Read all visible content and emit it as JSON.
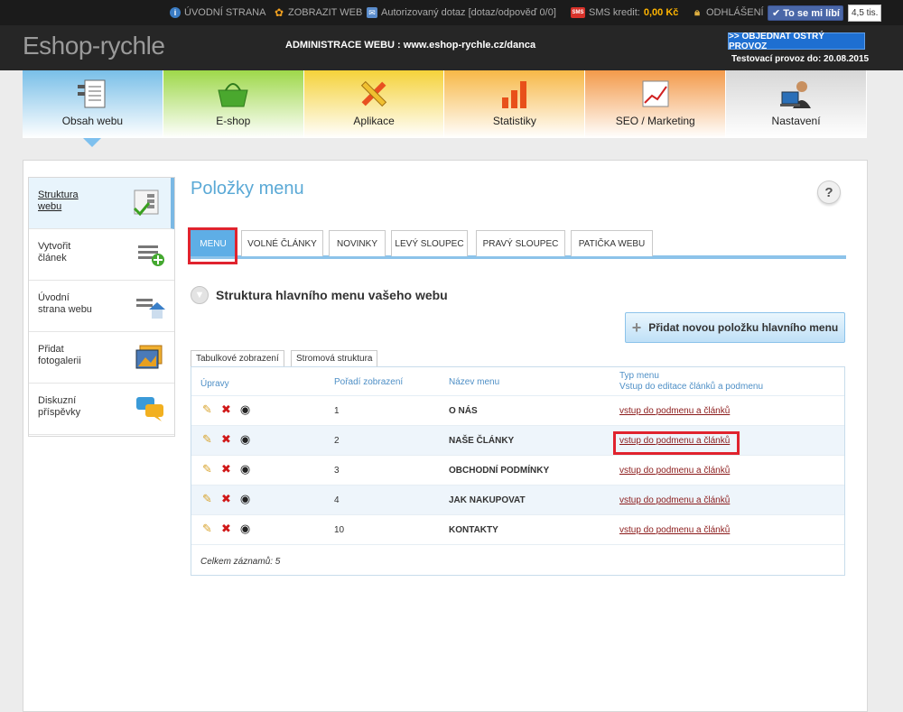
{
  "topbar": {
    "home": "ÚVODNÍ STRANA",
    "show_web": "ZOBRAZIT WEB",
    "query": "Autorizovaný dotaz [dotaz/odpověď 0/0]",
    "sms_label": "SMS kredit:",
    "sms_value": "0,00 Kč",
    "logout": "ODHLÁŠENÍ",
    "like": "To se mi líbí",
    "like_count": "4,5 tis.",
    "sms_badge": "SMS"
  },
  "header": {
    "logo": "Eshop-rychle",
    "admin_title": "ADMINISTRACE WEBU : www.eshop-rychle.cz/danca",
    "order_button": ">> OBJEDNAT OSTRÝ PROVOZ",
    "test_date": "Testovací provoz do: 20.08.2015"
  },
  "nav": [
    {
      "label": "Obsah webu",
      "icon": "document-list-icon",
      "color": "#79bfe8"
    },
    {
      "label": "E-shop",
      "icon": "basket-icon",
      "color": "#9ed84a"
    },
    {
      "label": "Aplikace",
      "icon": "tools-icon",
      "color": "#f5d23a"
    },
    {
      "label": "Statistiky",
      "icon": "bar-chart-icon",
      "color": "#f7b847"
    },
    {
      "label": "SEO / Marketing",
      "icon": "growth-chart-icon",
      "color": "#f39a4a"
    },
    {
      "label": "Nastavení",
      "icon": "person-laptop-icon",
      "color": "#d7d7d7"
    }
  ],
  "sidebar": [
    {
      "label": "Struktura webu",
      "icon": "sitemap-check-icon"
    },
    {
      "label": "Vytvořit článek",
      "icon": "add-article-icon"
    },
    {
      "label": "Úvodní strana webu",
      "icon": "home-page-icon"
    },
    {
      "label": "Přidat fotogalerii",
      "icon": "gallery-icon"
    },
    {
      "label": "Diskuzní příspěvky",
      "icon": "chat-bubbles-icon"
    }
  ],
  "page": {
    "title": "Položky menu",
    "help": "?",
    "tabs": [
      "MENU",
      "VOLNÉ ČLÁNKY",
      "NOVINKY",
      "LEVÝ SLOUPEC",
      "PRAVÝ SLOUPEC",
      "PATIČKA WEBU"
    ],
    "section_title": "Struktura hlavního menu vašeho webu",
    "add_button": "Přidat novou položku hlavního menu",
    "view_tabs": [
      "Tabulkové zobrazení",
      "Stromová struktura"
    ]
  },
  "table": {
    "headers": {
      "actions": "Úpravy",
      "order": "Pořadí zobrazení",
      "name": "Název menu",
      "type_line1": "Typ menu",
      "type_line2": "Vstup do editace článků a podmenu"
    },
    "rows": [
      {
        "order": "1",
        "name": "O NÁS",
        "link": "vstup do podmenu a článků"
      },
      {
        "order": "2",
        "name": "NAŠE ČLÁNKY",
        "link": "vstup do podmenu a článků"
      },
      {
        "order": "3",
        "name": "OBCHODNÍ PODMÍNKY",
        "link": "vstup do podmenu a článků"
      },
      {
        "order": "4",
        "name": "JAK NAKUPOVAT",
        "link": "vstup do podmenu a článků"
      },
      {
        "order": "10",
        "name": "KONTAKTY",
        "link": "vstup do podmenu a článků"
      }
    ],
    "total": "Celkem záznamů: 5"
  }
}
